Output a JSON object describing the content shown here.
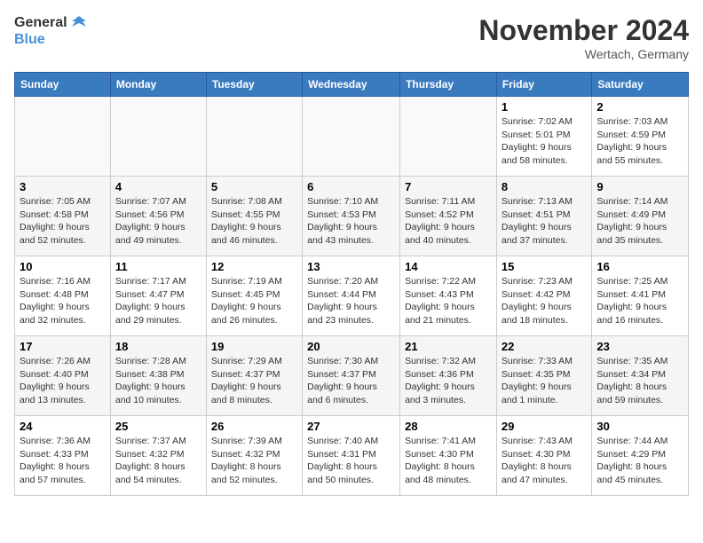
{
  "logo": {
    "line1": "General",
    "line2": "Blue"
  },
  "title": "November 2024",
  "location": "Wertach, Germany",
  "days_of_week": [
    "Sunday",
    "Monday",
    "Tuesday",
    "Wednesday",
    "Thursday",
    "Friday",
    "Saturday"
  ],
  "weeks": [
    [
      {
        "day": "",
        "info": ""
      },
      {
        "day": "",
        "info": ""
      },
      {
        "day": "",
        "info": ""
      },
      {
        "day": "",
        "info": ""
      },
      {
        "day": "",
        "info": ""
      },
      {
        "day": "1",
        "info": "Sunrise: 7:02 AM\nSunset: 5:01 PM\nDaylight: 9 hours and 58 minutes."
      },
      {
        "day": "2",
        "info": "Sunrise: 7:03 AM\nSunset: 4:59 PM\nDaylight: 9 hours and 55 minutes."
      }
    ],
    [
      {
        "day": "3",
        "info": "Sunrise: 7:05 AM\nSunset: 4:58 PM\nDaylight: 9 hours and 52 minutes."
      },
      {
        "day": "4",
        "info": "Sunrise: 7:07 AM\nSunset: 4:56 PM\nDaylight: 9 hours and 49 minutes."
      },
      {
        "day": "5",
        "info": "Sunrise: 7:08 AM\nSunset: 4:55 PM\nDaylight: 9 hours and 46 minutes."
      },
      {
        "day": "6",
        "info": "Sunrise: 7:10 AM\nSunset: 4:53 PM\nDaylight: 9 hours and 43 minutes."
      },
      {
        "day": "7",
        "info": "Sunrise: 7:11 AM\nSunset: 4:52 PM\nDaylight: 9 hours and 40 minutes."
      },
      {
        "day": "8",
        "info": "Sunrise: 7:13 AM\nSunset: 4:51 PM\nDaylight: 9 hours and 37 minutes."
      },
      {
        "day": "9",
        "info": "Sunrise: 7:14 AM\nSunset: 4:49 PM\nDaylight: 9 hours and 35 minutes."
      }
    ],
    [
      {
        "day": "10",
        "info": "Sunrise: 7:16 AM\nSunset: 4:48 PM\nDaylight: 9 hours and 32 minutes."
      },
      {
        "day": "11",
        "info": "Sunrise: 7:17 AM\nSunset: 4:47 PM\nDaylight: 9 hours and 29 minutes."
      },
      {
        "day": "12",
        "info": "Sunrise: 7:19 AM\nSunset: 4:45 PM\nDaylight: 9 hours and 26 minutes."
      },
      {
        "day": "13",
        "info": "Sunrise: 7:20 AM\nSunset: 4:44 PM\nDaylight: 9 hours and 23 minutes."
      },
      {
        "day": "14",
        "info": "Sunrise: 7:22 AM\nSunset: 4:43 PM\nDaylight: 9 hours and 21 minutes."
      },
      {
        "day": "15",
        "info": "Sunrise: 7:23 AM\nSunset: 4:42 PM\nDaylight: 9 hours and 18 minutes."
      },
      {
        "day": "16",
        "info": "Sunrise: 7:25 AM\nSunset: 4:41 PM\nDaylight: 9 hours and 16 minutes."
      }
    ],
    [
      {
        "day": "17",
        "info": "Sunrise: 7:26 AM\nSunset: 4:40 PM\nDaylight: 9 hours and 13 minutes."
      },
      {
        "day": "18",
        "info": "Sunrise: 7:28 AM\nSunset: 4:38 PM\nDaylight: 9 hours and 10 minutes."
      },
      {
        "day": "19",
        "info": "Sunrise: 7:29 AM\nSunset: 4:37 PM\nDaylight: 9 hours and 8 minutes."
      },
      {
        "day": "20",
        "info": "Sunrise: 7:30 AM\nSunset: 4:37 PM\nDaylight: 9 hours and 6 minutes."
      },
      {
        "day": "21",
        "info": "Sunrise: 7:32 AM\nSunset: 4:36 PM\nDaylight: 9 hours and 3 minutes."
      },
      {
        "day": "22",
        "info": "Sunrise: 7:33 AM\nSunset: 4:35 PM\nDaylight: 9 hours and 1 minute."
      },
      {
        "day": "23",
        "info": "Sunrise: 7:35 AM\nSunset: 4:34 PM\nDaylight: 8 hours and 59 minutes."
      }
    ],
    [
      {
        "day": "24",
        "info": "Sunrise: 7:36 AM\nSunset: 4:33 PM\nDaylight: 8 hours and 57 minutes."
      },
      {
        "day": "25",
        "info": "Sunrise: 7:37 AM\nSunset: 4:32 PM\nDaylight: 8 hours and 54 minutes."
      },
      {
        "day": "26",
        "info": "Sunrise: 7:39 AM\nSunset: 4:32 PM\nDaylight: 8 hours and 52 minutes."
      },
      {
        "day": "27",
        "info": "Sunrise: 7:40 AM\nSunset: 4:31 PM\nDaylight: 8 hours and 50 minutes."
      },
      {
        "day": "28",
        "info": "Sunrise: 7:41 AM\nSunset: 4:30 PM\nDaylight: 8 hours and 48 minutes."
      },
      {
        "day": "29",
        "info": "Sunrise: 7:43 AM\nSunset: 4:30 PM\nDaylight: 8 hours and 47 minutes."
      },
      {
        "day": "30",
        "info": "Sunrise: 7:44 AM\nSunset: 4:29 PM\nDaylight: 8 hours and 45 minutes."
      }
    ]
  ]
}
